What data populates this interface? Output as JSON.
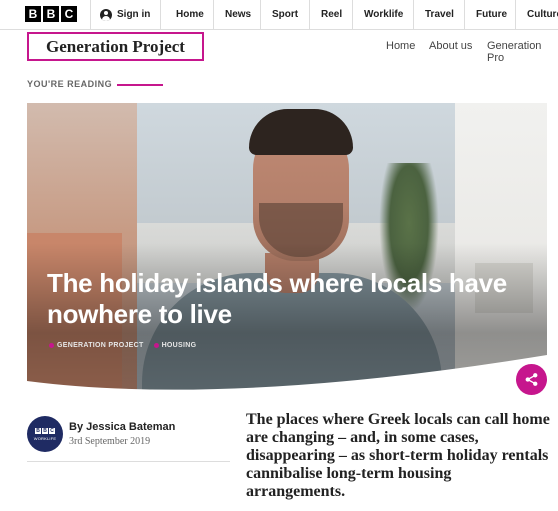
{
  "brand": {
    "letters": [
      "B",
      "B",
      "C"
    ]
  },
  "topbar": {
    "sign_in_label": "Sign in",
    "nav": [
      "Home",
      "News",
      "Sport",
      "Reel",
      "Worklife",
      "Travel",
      "Future",
      "Culture"
    ]
  },
  "section": {
    "title": "Generation Project",
    "nav": [
      "Home",
      "About us",
      "Generation Pro"
    ]
  },
  "reading_label": "YOU'RE READING",
  "article": {
    "headline": "The holiday islands where locals have nowhere to live",
    "tags": [
      "GENERATION PROJECT",
      "HOUSING"
    ],
    "author": "By Jessica Bateman",
    "date": "3rd September 2019",
    "avatar_letters": [
      "B",
      "B",
      "C"
    ],
    "avatar_text": "WORKLIFE",
    "summary": "The places where Greek locals can call home are changing – and, in some cases, disappearing – as short-term holiday rentals cannibalise long-term housing arrangements."
  },
  "colors": {
    "accent": "#c6168d",
    "avatar_bg": "#1f2b63"
  },
  "icons": {
    "share": "share-icon",
    "user": "user-icon"
  }
}
